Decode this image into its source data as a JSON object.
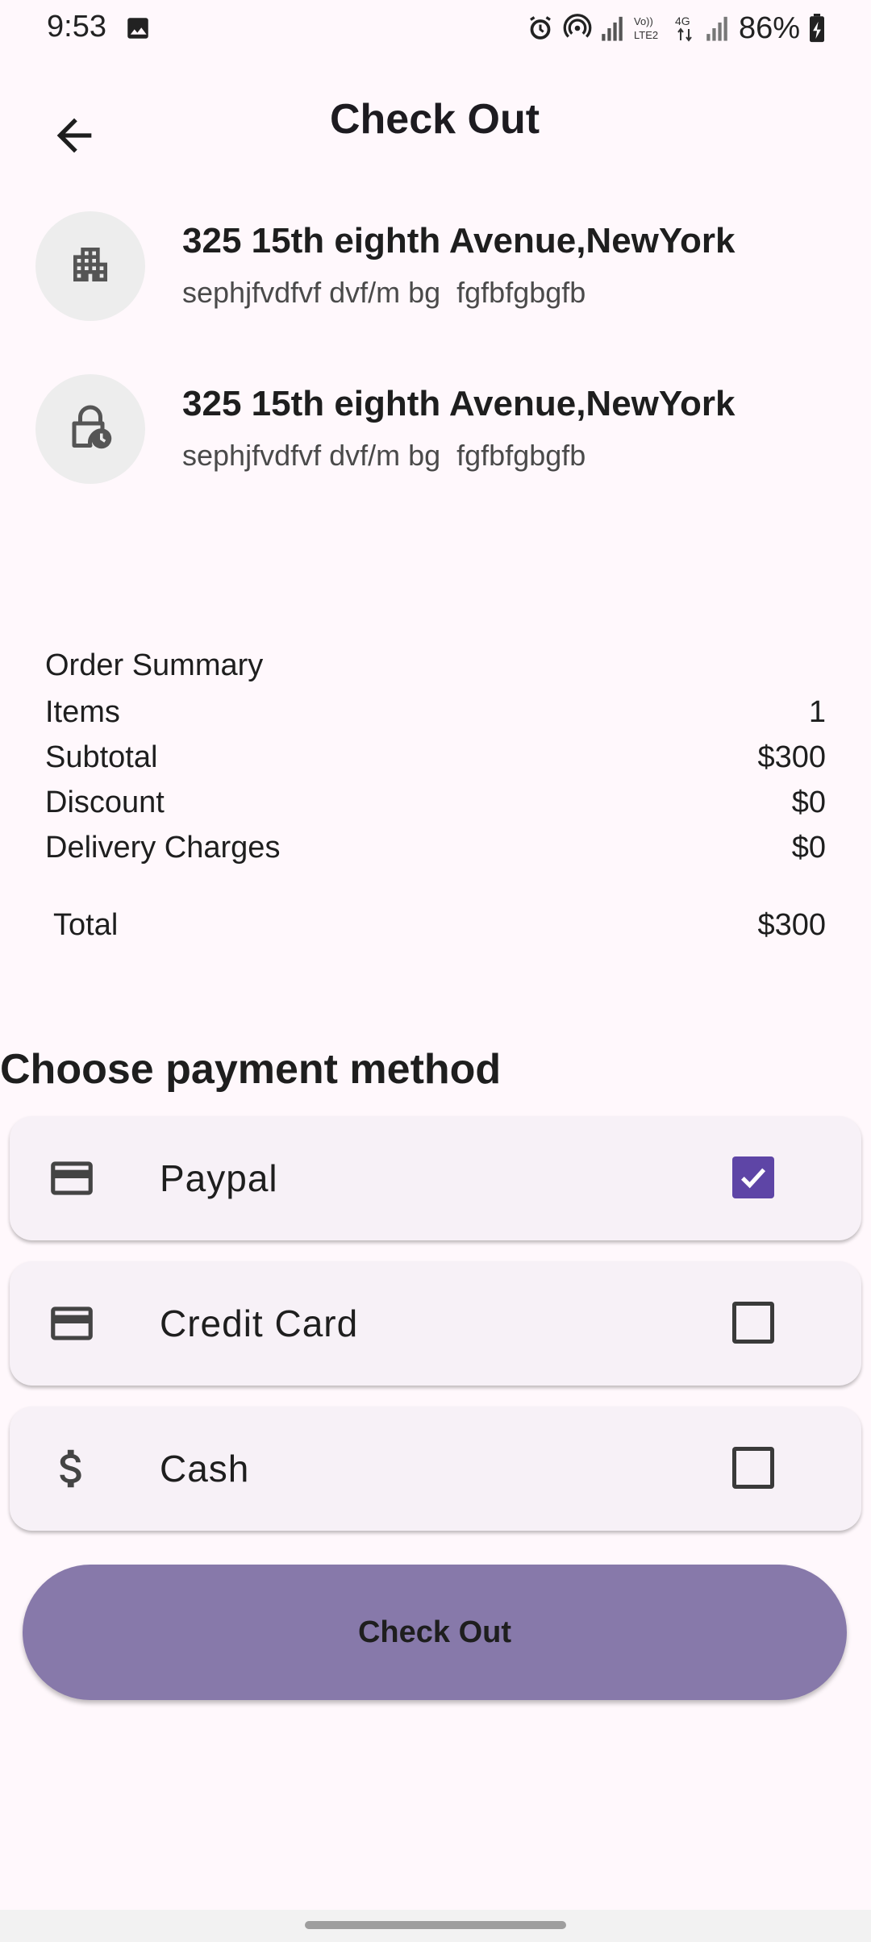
{
  "status_bar": {
    "time": "9:53",
    "battery": "86%"
  },
  "header": {
    "title": "Check Out"
  },
  "addresses": [
    {
      "title": "325 15th eighth Avenue,NewYork",
      "subtitle": "sephjfvdfvf dvf/m bg  fgfbfgbgfb",
      "icon": "apartment-icon"
    },
    {
      "title": "325 15th eighth Avenue,NewYork",
      "subtitle": "sephjfvdfvf dvf/m bg  fgfbfgbgfb",
      "icon": "lock-clock-icon"
    }
  ],
  "order_summary": {
    "heading": "Order Summary",
    "items": {
      "label": "Items",
      "value": "1"
    },
    "subtotal": {
      "label": "Subtotal",
      "value": "$300"
    },
    "discount": {
      "label": "Discount",
      "value": "$0"
    },
    "delivery": {
      "label": "Delivery Charges",
      "value": "$0"
    },
    "total": {
      "label": "Total",
      "value": "$300"
    }
  },
  "payment": {
    "heading": "Choose payment method",
    "methods": [
      {
        "label": "Paypal",
        "icon": "credit-card-icon",
        "checked": true
      },
      {
        "label": "Credit Card",
        "icon": "credit-card-icon",
        "checked": false
      },
      {
        "label": "Cash",
        "icon": "dollar-icon",
        "checked": false
      }
    ]
  },
  "checkout_button": {
    "label": "Check Out"
  },
  "colors": {
    "background": "#FFF8FC",
    "accent": "#5E45A6",
    "button": "#8779AA",
    "card": "#F7F1F7"
  }
}
